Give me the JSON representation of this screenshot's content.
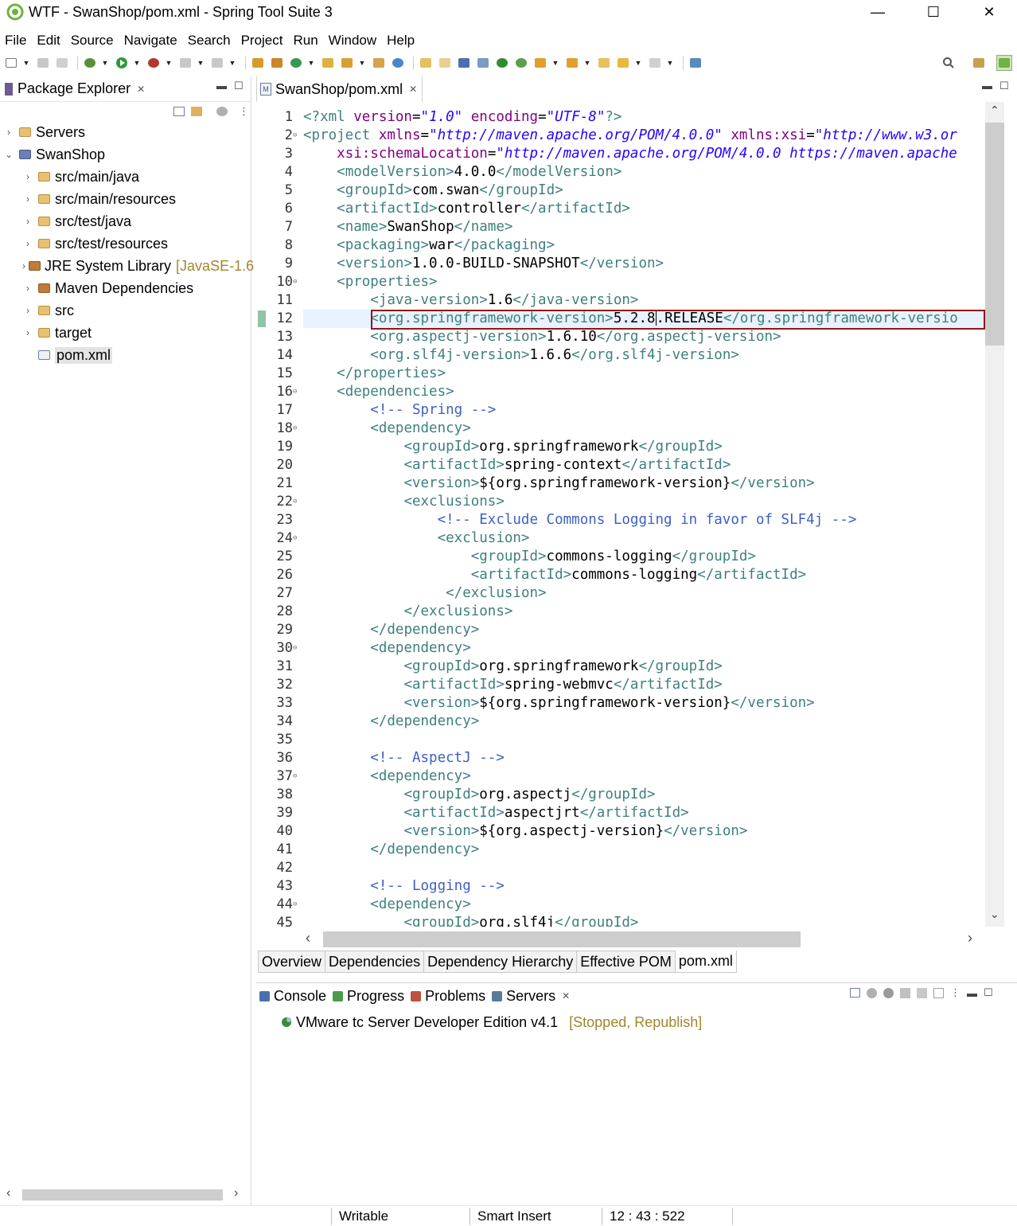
{
  "window": {
    "title": "WTF - SwanShop/pom.xml - Spring Tool Suite 3",
    "minimize": "—",
    "maximize": "☐",
    "close": "✕"
  },
  "menu": [
    "File",
    "Edit",
    "Source",
    "Navigate",
    "Search",
    "Project",
    "Run",
    "Window",
    "Help"
  ],
  "explorer": {
    "tab_label": "Package Explorer",
    "close_glyph": "✕",
    "items": [
      {
        "label": "Servers",
        "level": 0,
        "twisty": "›",
        "icon": "folder-icon"
      },
      {
        "label": "SwanShop",
        "level": 0,
        "twisty": "⌄",
        "icon": "maven-project-icon"
      },
      {
        "label": "src/main/java",
        "level": 1,
        "twisty": "›",
        "icon": "source-folder-icon"
      },
      {
        "label": "src/main/resources",
        "level": 1,
        "twisty": "›",
        "icon": "source-folder-icon"
      },
      {
        "label": "src/test/java",
        "level": 1,
        "twisty": "›",
        "icon": "source-folder-icon"
      },
      {
        "label": "src/test/resources",
        "level": 1,
        "twisty": "›",
        "icon": "source-folder-icon"
      },
      {
        "label": "JRE System Library",
        "decoration": "[JavaSE-1.6",
        "level": 1,
        "twisty": "›",
        "icon": "library-icon"
      },
      {
        "label": "Maven Dependencies",
        "level": 1,
        "twisty": "›",
        "icon": "library-icon"
      },
      {
        "label": "src",
        "level": 1,
        "twisty": "›",
        "icon": "folder-icon"
      },
      {
        "label": "target",
        "level": 1,
        "twisty": "›",
        "icon": "folder-icon"
      },
      {
        "label": "pom.xml",
        "level": 1,
        "twisty": "",
        "icon": "xml-file-icon",
        "selected": true
      }
    ]
  },
  "editor": {
    "tab_label": "SwanShop/pom.xml",
    "close_glyph": "✕",
    "current_line": 12,
    "bottom_tabs": [
      "Overview",
      "Dependencies",
      "Dependency Hierarchy",
      "Effective POM",
      "pom.xml"
    ],
    "active_bottom_tab": 4,
    "lines": [
      {
        "n": "1",
        "fold": "",
        "segs": [
          [
            "t",
            "<?xml "
          ],
          [
            "a",
            "version"
          ],
          [
            "x",
            "="
          ],
          [
            "v",
            "\"1.0\""
          ],
          [
            "x",
            " "
          ],
          [
            "a",
            "encoding"
          ],
          [
            "x",
            "="
          ],
          [
            "v",
            "\"UTF-8\""
          ],
          [
            "t",
            "?>"
          ]
        ]
      },
      {
        "n": "2",
        "fold": "⊖",
        "segs": [
          [
            "t",
            "<project "
          ],
          [
            "a",
            "xmlns"
          ],
          [
            "x",
            "="
          ],
          [
            "v",
            "\"http://maven.apache.org/POM/4.0.0\""
          ],
          [
            "x",
            " "
          ],
          [
            "a",
            "xmlns:xsi"
          ],
          [
            "x",
            "="
          ],
          [
            "v",
            "\"http://www.w3.or"
          ]
        ]
      },
      {
        "n": "3",
        "fold": "",
        "segs": [
          [
            "x",
            "    "
          ],
          [
            "a",
            "xsi:schemaLocation"
          ],
          [
            "x",
            "="
          ],
          [
            "v",
            "\"http://maven.apache.org/POM/4.0.0 https://maven.apache"
          ]
        ]
      },
      {
        "n": "4",
        "fold": "",
        "segs": [
          [
            "x",
            "    "
          ],
          [
            "t",
            "<modelVersion>"
          ],
          [
            "x",
            "4.0.0"
          ],
          [
            "t",
            "</modelVersion>"
          ]
        ]
      },
      {
        "n": "5",
        "fold": "",
        "segs": [
          [
            "x",
            "    "
          ],
          [
            "t",
            "<groupId>"
          ],
          [
            "x",
            "com.swan"
          ],
          [
            "t",
            "</groupId>"
          ]
        ]
      },
      {
        "n": "6",
        "fold": "",
        "segs": [
          [
            "x",
            "    "
          ],
          [
            "t",
            "<artifactId>"
          ],
          [
            "x",
            "controller"
          ],
          [
            "t",
            "</artifactId>"
          ]
        ]
      },
      {
        "n": "7",
        "fold": "",
        "segs": [
          [
            "x",
            "    "
          ],
          [
            "t",
            "<name>"
          ],
          [
            "x",
            "SwanShop"
          ],
          [
            "t",
            "</name>"
          ]
        ]
      },
      {
        "n": "8",
        "fold": "",
        "segs": [
          [
            "x",
            "    "
          ],
          [
            "t",
            "<packaging>"
          ],
          [
            "x",
            "war"
          ],
          [
            "t",
            "</packaging>"
          ]
        ]
      },
      {
        "n": "9",
        "fold": "",
        "segs": [
          [
            "x",
            "    "
          ],
          [
            "t",
            "<version>"
          ],
          [
            "x",
            "1.0.0-BUILD-SNAPSHOT"
          ],
          [
            "t",
            "</version>"
          ]
        ]
      },
      {
        "n": "10",
        "fold": "⊖",
        "segs": [
          [
            "x",
            "    "
          ],
          [
            "t",
            "<properties>"
          ]
        ]
      },
      {
        "n": "11",
        "fold": "",
        "segs": [
          [
            "x",
            "        "
          ],
          [
            "t",
            "<java-version>"
          ],
          [
            "x",
            "1.6"
          ],
          [
            "t",
            "</java-version>"
          ]
        ]
      },
      {
        "n": "12",
        "fold": "",
        "segs": [
          [
            "x",
            "        "
          ],
          [
            "t",
            "<org.springframework-version>"
          ],
          [
            "x",
            "5.2.8"
          ],
          [
            "caret",
            ""
          ],
          [
            "x",
            ".RELEASE"
          ],
          [
            "t",
            "</org.springframework-versio"
          ]
        ]
      },
      {
        "n": "13",
        "fold": "",
        "segs": [
          [
            "x",
            "        "
          ],
          [
            "t",
            "<org.aspectj-version>"
          ],
          [
            "x",
            "1.6.10"
          ],
          [
            "t",
            "</org.aspectj-version>"
          ]
        ]
      },
      {
        "n": "14",
        "fold": "",
        "segs": [
          [
            "x",
            "        "
          ],
          [
            "t",
            "<org.slf4j-version>"
          ],
          [
            "x",
            "1.6.6"
          ],
          [
            "t",
            "</org.slf4j-version>"
          ]
        ]
      },
      {
        "n": "15",
        "fold": "",
        "segs": [
          [
            "x",
            "    "
          ],
          [
            "t",
            "</properties>"
          ]
        ]
      },
      {
        "n": "16",
        "fold": "⊖",
        "segs": [
          [
            "x",
            "    "
          ],
          [
            "t",
            "<dependencies>"
          ]
        ]
      },
      {
        "n": "17",
        "fold": "",
        "segs": [
          [
            "x",
            "        "
          ],
          [
            "c",
            "<!-- Spring -->"
          ]
        ]
      },
      {
        "n": "18",
        "fold": "⊖",
        "segs": [
          [
            "x",
            "        "
          ],
          [
            "t",
            "<dependency>"
          ]
        ]
      },
      {
        "n": "19",
        "fold": "",
        "segs": [
          [
            "x",
            "            "
          ],
          [
            "t",
            "<groupId>"
          ],
          [
            "x",
            "org.springframework"
          ],
          [
            "t",
            "</groupId>"
          ]
        ]
      },
      {
        "n": "20",
        "fold": "",
        "segs": [
          [
            "x",
            "            "
          ],
          [
            "t",
            "<artifactId>"
          ],
          [
            "x",
            "spring-context"
          ],
          [
            "t",
            "</artifactId>"
          ]
        ]
      },
      {
        "n": "21",
        "fold": "",
        "segs": [
          [
            "x",
            "            "
          ],
          [
            "t",
            "<version>"
          ],
          [
            "x",
            "${org.springframework-version}"
          ],
          [
            "t",
            "</version>"
          ]
        ]
      },
      {
        "n": "22",
        "fold": "⊖",
        "segs": [
          [
            "x",
            "            "
          ],
          [
            "t",
            "<exclusions>"
          ]
        ]
      },
      {
        "n": "23",
        "fold": "",
        "segs": [
          [
            "x",
            "                "
          ],
          [
            "c",
            "<!-- Exclude Commons Logging in favor of SLF4j -->"
          ]
        ]
      },
      {
        "n": "24",
        "fold": "⊖",
        "segs": [
          [
            "x",
            "                "
          ],
          [
            "t",
            "<exclusion>"
          ]
        ]
      },
      {
        "n": "25",
        "fold": "",
        "segs": [
          [
            "x",
            "                    "
          ],
          [
            "t",
            "<groupId>"
          ],
          [
            "x",
            "commons-logging"
          ],
          [
            "t",
            "</groupId>"
          ]
        ]
      },
      {
        "n": "26",
        "fold": "",
        "segs": [
          [
            "x",
            "                    "
          ],
          [
            "t",
            "<artifactId>"
          ],
          [
            "x",
            "commons-logging"
          ],
          [
            "t",
            "</artifactId>"
          ]
        ]
      },
      {
        "n": "27",
        "fold": "",
        "segs": [
          [
            "x",
            "                 "
          ],
          [
            "t",
            "</exclusion>"
          ]
        ]
      },
      {
        "n": "28",
        "fold": "",
        "segs": [
          [
            "x",
            "            "
          ],
          [
            "t",
            "</exclusions>"
          ]
        ]
      },
      {
        "n": "29",
        "fold": "",
        "segs": [
          [
            "x",
            "        "
          ],
          [
            "t",
            "</dependency>"
          ]
        ]
      },
      {
        "n": "30",
        "fold": "⊖",
        "segs": [
          [
            "x",
            "        "
          ],
          [
            "t",
            "<dependency>"
          ]
        ]
      },
      {
        "n": "31",
        "fold": "",
        "segs": [
          [
            "x",
            "            "
          ],
          [
            "t",
            "<groupId>"
          ],
          [
            "x",
            "org.springframework"
          ],
          [
            "t",
            "</groupId>"
          ]
        ]
      },
      {
        "n": "32",
        "fold": "",
        "segs": [
          [
            "x",
            "            "
          ],
          [
            "t",
            "<artifactId>"
          ],
          [
            "x",
            "spring-webmvc"
          ],
          [
            "t",
            "</artifactId>"
          ]
        ]
      },
      {
        "n": "33",
        "fold": "",
        "segs": [
          [
            "x",
            "            "
          ],
          [
            "t",
            "<version>"
          ],
          [
            "x",
            "${org.springframework-version}"
          ],
          [
            "t",
            "</version>"
          ]
        ]
      },
      {
        "n": "34",
        "fold": "",
        "segs": [
          [
            "x",
            "        "
          ],
          [
            "t",
            "</dependency>"
          ]
        ]
      },
      {
        "n": "35",
        "fold": "",
        "segs": []
      },
      {
        "n": "36",
        "fold": "",
        "segs": [
          [
            "x",
            "        "
          ],
          [
            "c",
            "<!-- AspectJ -->"
          ]
        ]
      },
      {
        "n": "37",
        "fold": "⊖",
        "segs": [
          [
            "x",
            "        "
          ],
          [
            "t",
            "<dependency>"
          ]
        ]
      },
      {
        "n": "38",
        "fold": "",
        "segs": [
          [
            "x",
            "            "
          ],
          [
            "t",
            "<groupId>"
          ],
          [
            "x",
            "org.aspectj"
          ],
          [
            "t",
            "</groupId>"
          ]
        ]
      },
      {
        "n": "39",
        "fold": "",
        "segs": [
          [
            "x",
            "            "
          ],
          [
            "t",
            "<artifactId>"
          ],
          [
            "x",
            "aspectjrt"
          ],
          [
            "t",
            "</artifactId>"
          ]
        ]
      },
      {
        "n": "40",
        "fold": "",
        "segs": [
          [
            "x",
            "            "
          ],
          [
            "t",
            "<version>"
          ],
          [
            "x",
            "${org.aspectj-version}"
          ],
          [
            "t",
            "</version>"
          ]
        ]
      },
      {
        "n": "41",
        "fold": "",
        "segs": [
          [
            "x",
            "        "
          ],
          [
            "t",
            "</dependency>"
          ]
        ]
      },
      {
        "n": "42",
        "fold": "",
        "segs": []
      },
      {
        "n": "43",
        "fold": "",
        "segs": [
          [
            "x",
            "        "
          ],
          [
            "c",
            "<!-- Logging -->"
          ]
        ]
      },
      {
        "n": "44",
        "fold": "⊖",
        "segs": [
          [
            "x",
            "        "
          ],
          [
            "t",
            "<dependency>"
          ]
        ]
      },
      {
        "n": "45",
        "fold": "",
        "segs": [
          [
            "x",
            "            "
          ],
          [
            "t",
            "<groupId>"
          ],
          [
            "x",
            "org.slf4j"
          ],
          [
            "t",
            "</groupId>"
          ]
        ]
      }
    ]
  },
  "bottom_panel": {
    "tabs": [
      {
        "label": "Console",
        "icon": "console-icon"
      },
      {
        "label": "Progress",
        "icon": "progress-icon"
      },
      {
        "label": "Problems",
        "icon": "problems-icon"
      },
      {
        "label": "Servers",
        "icon": "servers-icon",
        "active": true
      }
    ],
    "server": {
      "name": "VMware tc Server Developer Edition v4.1",
      "status": "[Stopped, Republish]"
    }
  },
  "statusbar": {
    "writable": "Writable",
    "insert_mode": "Smart Insert",
    "position": "12 : 43 : 522"
  },
  "colors": {
    "tag": "#3f7f7f",
    "attribute": "#7f007f",
    "string": "#2a00ff",
    "comment": "#3f5fbf",
    "current_line": "#e8f2fe",
    "highlight_box": "#8b1a1a",
    "decoration": "#a0872d"
  }
}
